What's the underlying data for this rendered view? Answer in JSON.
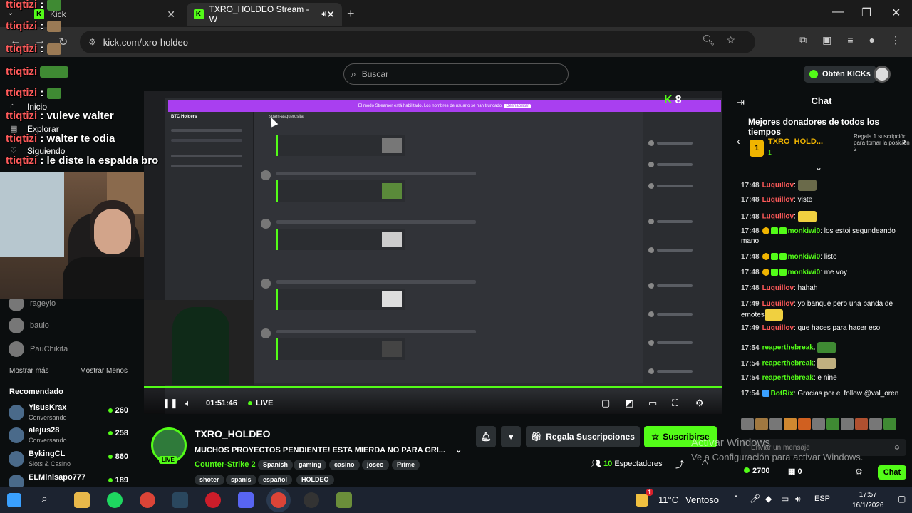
{
  "browser": {
    "tabs": [
      {
        "title": "Kick",
        "active": false
      },
      {
        "title": "TXRO_HOLDEO Stream - W",
        "active": true
      }
    ],
    "url": "kick.com/txro-holdeo"
  },
  "header": {
    "search_placeholder": "Buscar",
    "kicks_button": "Obtén KICKs"
  },
  "sidebar": {
    "nav": [
      {
        "label": "Inicio",
        "icon": "home-icon"
      },
      {
        "label": "Explorar",
        "icon": "explore-icon"
      },
      {
        "label": "Siguiendo",
        "icon": "heart-icon"
      }
    ],
    "following": [
      "rageylo",
      "baulo",
      "PauChikita"
    ],
    "show_more": "Mostrar más",
    "show_less": "Mostrar Menos",
    "recommended_title": "Recomendado",
    "recommended": [
      {
        "name": "YisusKrax",
        "category": "Conversando",
        "viewers": "260"
      },
      {
        "name": "alejus28",
        "category": "Conversando",
        "viewers": "258"
      },
      {
        "name": "BykingCL",
        "category": "Slots & Casino",
        "viewers": "860"
      },
      {
        "name": "ELMinisapo777",
        "category": "",
        "viewers": "189"
      }
    ]
  },
  "overlay_chat": [
    {
      "user": "ttiqtizi",
      "text": ""
    },
    {
      "user": "ttiqtizi",
      "text": ""
    },
    {
      "user": "ttiqtizi",
      "text": ""
    },
    {
      "user": "ttiqtizi",
      "text": ""
    },
    {
      "user": "ttiqtizi",
      "text": ""
    },
    {
      "user": "ttiqtizi",
      "text": "vuleve walter"
    },
    {
      "user": "ttiqtizi",
      "text": "walter te odia"
    },
    {
      "user": "ttiqtizi",
      "text": "le diste la espalda bro"
    }
  ],
  "player": {
    "time": "01:51:46",
    "live_label": "LIVE",
    "discord_server": "BTC Holders",
    "discord_channel": "spam-asquerosita",
    "discord_banner": "El modo Streamer está habilitado. Los nombres de usuario se han truncado.",
    "discord_banner_button": "Deshabilitar",
    "overlay_count": "8",
    "overlay_brand": "K"
  },
  "stream": {
    "channel": "TXRO_HOLDEO",
    "live_badge": "LIVE",
    "title": "MUCHOS PROYECTOS PENDIENTE! ESTA MIERDA NO PARA GRI...",
    "category": "Counter-Strike 2",
    "tags_row1": [
      "Spanish",
      "gaming",
      "casino",
      "joseo",
      "Prime"
    ],
    "tags_row2": [
      "shoter",
      "spanis",
      "español",
      "HOLDEO"
    ],
    "gift_subs": "Regala Suscripciones",
    "subscribe": "Suscribirse",
    "viewers_count": "10",
    "viewers_label": "Espectadores"
  },
  "chat": {
    "title": "Chat",
    "donors_title": "Mejores donadores de todos los tiempos",
    "top_donor": {
      "rank": "1",
      "name": "TXRO_HOLD...",
      "count": "1",
      "hint": "Regala 1 suscripción para tomar la posición 2"
    },
    "messages": [
      {
        "time": "17:48",
        "user": "Luquillov",
        "color": "#ff5a5a",
        "text": "",
        "badges": 0
      },
      {
        "time": "17:48",
        "user": "Luquillov",
        "color": "#ff5a5a",
        "text": "viste",
        "badges": 0
      },
      {
        "time": "17:48",
        "user": "Luquillov",
        "color": "#ff5a5a",
        "text": "",
        "badges": 0
      },
      {
        "time": "17:48",
        "user": "monkiwi0",
        "color": "#53fc18",
        "text": "los estoi segundeando mano",
        "badges": 3
      },
      {
        "time": "17:48",
        "user": "monkiwi0",
        "color": "#53fc18",
        "text": "listo",
        "badges": 3
      },
      {
        "time": "17:48",
        "user": "monkiwi0",
        "color": "#53fc18",
        "text": "me voy",
        "badges": 3
      },
      {
        "time": "17:48",
        "user": "Luquillov",
        "color": "#ff5a5a",
        "text": "hahah",
        "badges": 0
      },
      {
        "time": "17:49",
        "user": "Luquillov",
        "color": "#ff5a5a",
        "text": "yo banque pero una banda de emotes",
        "badges": 0
      },
      {
        "time": "17:49",
        "user": "Luquillov",
        "color": "#ff5a5a",
        "text": "que haces para hacer eso",
        "badges": 0
      },
      {
        "time": "17:54",
        "user": "reaperthebreak",
        "color": "#53fc18",
        "text": "",
        "badges": 0
      },
      {
        "time": "17:54",
        "user": "reaperthebreak",
        "color": "#53fc18",
        "text": "",
        "badges": 0
      },
      {
        "time": "17:54",
        "user": "reaperthebreak",
        "color": "#53fc18",
        "text": "e nine",
        "badges": 0
      },
      {
        "time": "17:54",
        "user": "BotRix",
        "color": "#53fc18",
        "text": "Gracias por el follow @val_oren",
        "badges": 1
      }
    ],
    "input_placeholder": "Enviar un mensaje",
    "points": "2700",
    "gifts": "0",
    "send_label": "Chat"
  },
  "watermark": {
    "line1": "Activar Windows",
    "line2": "Ve a Configuración para activar Windows."
  },
  "taskbar": {
    "weather_temp": "11°C",
    "weather_label": "Ventoso",
    "lang": "ESP",
    "time": "17:57",
    "date": "16/1/2026",
    "notif": "1"
  },
  "colors": {
    "accent": "#53fc18",
    "user_red": "#ff5a5a",
    "gold": "#f0b400"
  }
}
